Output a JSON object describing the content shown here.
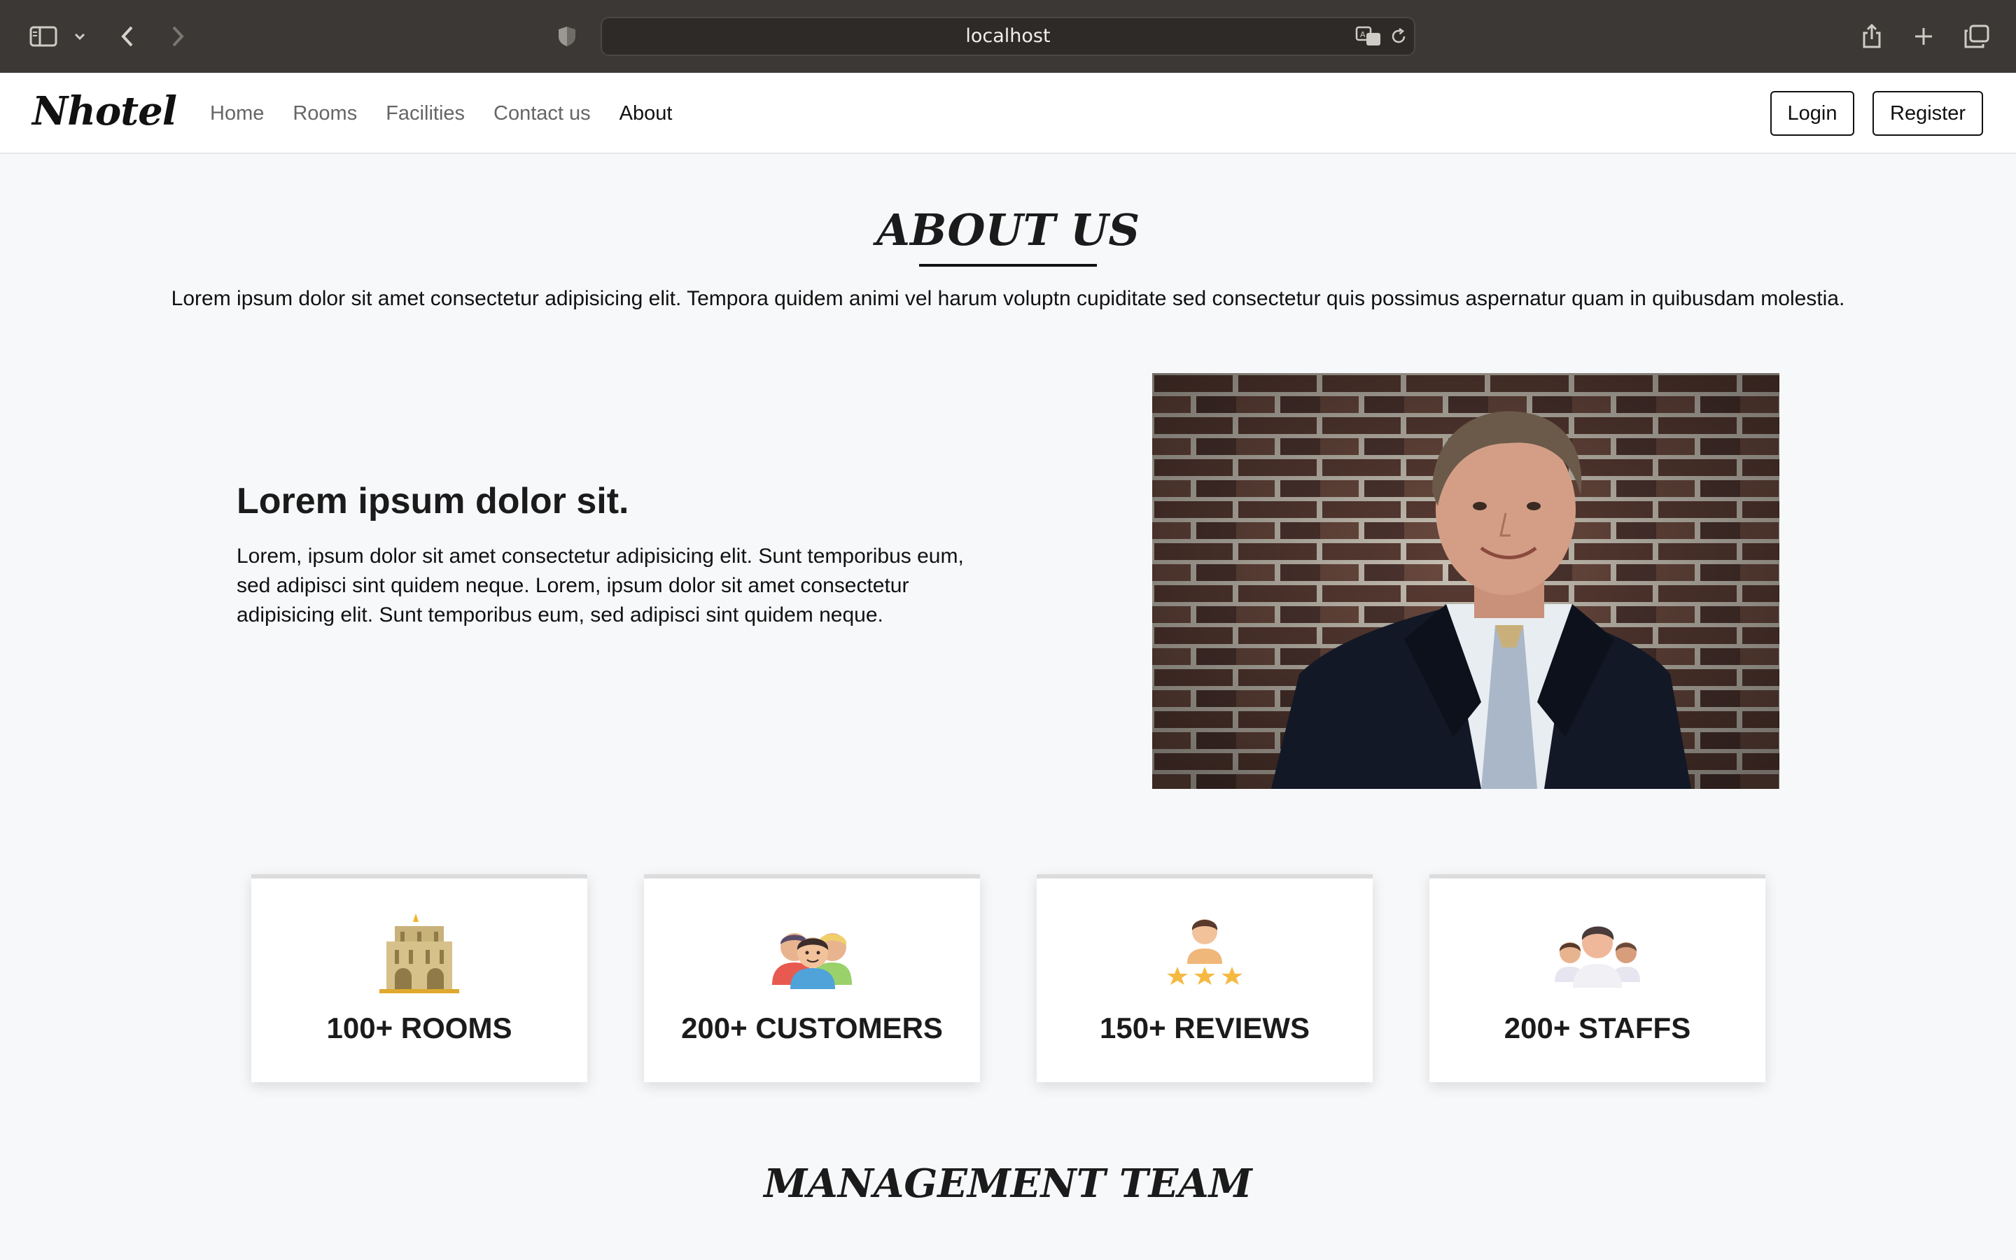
{
  "browser": {
    "url": "localhost",
    "icons": [
      "sidebar-icon",
      "chevron-down-icon",
      "back-icon",
      "forward-icon",
      "shield-icon",
      "translate-icon",
      "reload-icon",
      "share-icon",
      "new-tab-icon",
      "tabs-overview-icon"
    ]
  },
  "nav": {
    "logo": "Nhotel",
    "links": [
      "Home",
      "Rooms",
      "Facilities",
      "Contact us",
      "About"
    ],
    "active": "About",
    "login": "Login",
    "register": "Register"
  },
  "about": {
    "title": "ABOUT US",
    "intro": "Lorem ipsum dolor sit amet consectetur adipisicing elit. Tempora quidem animi vel harum voluptn cupiditate sed consectetur quis possimus aspernatur quam in quibusdam molestia.",
    "heading": "Lorem ipsum dolor sit.",
    "paragraph": "Lorem, ipsum dolor sit amet consectetur adipisicing elit. Sunt temporibus eum, sed adipisci sint quidem neque. Lorem, ipsum dolor sit amet consectetur adipisicing elit. Sunt temporibus eum, sed adipisci sint quidem neque."
  },
  "stats": [
    {
      "label": "100+ ROOMS",
      "icon": "hotel-building-icon"
    },
    {
      "label": "200+ CUSTOMERS",
      "icon": "customers-group-icon"
    },
    {
      "label": "150+ REVIEWS",
      "icon": "reviews-stars-icon"
    },
    {
      "label": "200+ STAFFS",
      "icon": "staff-team-icon"
    }
  ],
  "team": {
    "title": "MANAGEMENT TEAM"
  },
  "colors": {
    "chrome": "#3b3835",
    "page_bg": "#f7f8fa",
    "text": "#111111",
    "nav_link": "#666666"
  }
}
